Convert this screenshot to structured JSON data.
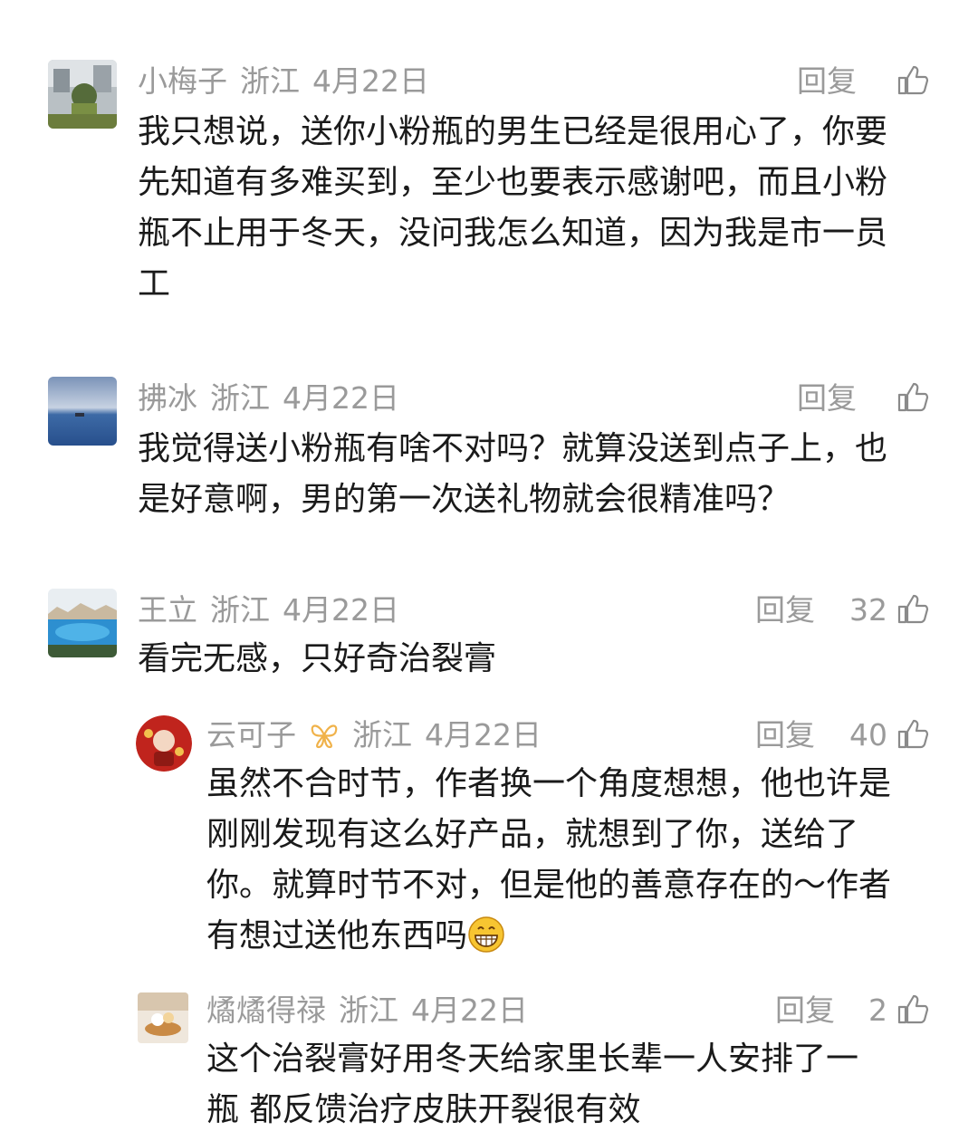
{
  "comments": [
    {
      "username": "小梅子",
      "location": "浙江",
      "date": "4月22日",
      "reply_label": "回复",
      "likes": "",
      "lines": [
        "我只想说，送你小粉瓶的男生已经是很用心了，你要",
        "先知道有多难买到，至少也要表示感谢吧，而且小粉",
        "瓶不止用于冬天，没问我怎么知道，因为我是市一员",
        "工"
      ]
    },
    {
      "username": "拂冰",
      "location": "浙江",
      "date": "4月22日",
      "reply_label": "回复",
      "likes": "",
      "lines": [
        "我觉得送小粉瓶有啥不对吗？就算没送到点子上，也",
        "是好意啊，男的第一次送礼物就会很精准吗？"
      ]
    },
    {
      "username": "王立",
      "location": "浙江",
      "date": "4月22日",
      "reply_label": "回复",
      "likes": "32",
      "lines": [
        "看完无感，只好奇治裂膏"
      ]
    },
    {
      "username": "云可子",
      "location": "浙江",
      "date": "4月22日",
      "reply_label": "回复",
      "likes": "40",
      "lines": [
        "虽然不合时节，作者换一个角度想想，他也许是",
        "刚刚发现有这么好产品，就想到了你，送给了",
        "你。就算时节不对，但是他的善意存在的～作者",
        "有想过送他东西吗"
      ]
    },
    {
      "username": "燏燏得禄",
      "location": "浙江",
      "date": "4月22日",
      "reply_label": "回复",
      "likes": "2",
      "lines": [
        "这个治裂膏好用冬天给家里长辈一人安排了一",
        "瓶 都反馈治疗皮肤开裂很有效"
      ]
    }
  ],
  "icons": {
    "like": "thumbs-up-icon",
    "vip": "butterfly-badge-icon",
    "emoji": "grinning-emoji-icon"
  }
}
